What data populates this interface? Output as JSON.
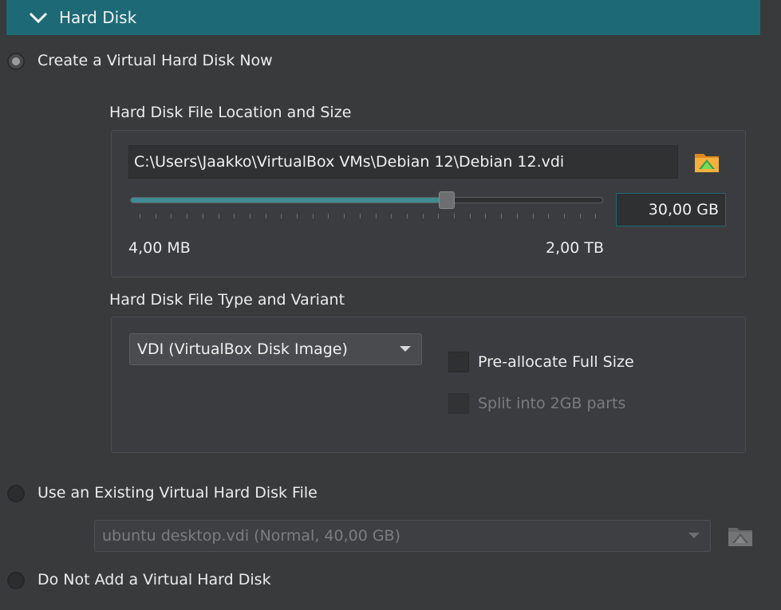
{
  "section": {
    "title": "Hard Disk"
  },
  "options": {
    "create": {
      "label": "Create a Virtual Hard Disk Now",
      "selected": true
    },
    "existing": {
      "label": "Use an Existing Virtual Hard Disk File",
      "selected": false
    },
    "none": {
      "label": "Do Not Add a Virtual Hard Disk",
      "selected": false
    }
  },
  "location": {
    "heading": "Hard Disk File Location and Size",
    "path": "C:\\Users\\Jaakko\\VirtualBox VMs\\Debian 12\\Debian 12.vdi",
    "folder_icon": "folder-browse-icon",
    "size_value": "30,00 GB",
    "slider_fraction": 0.67,
    "min_label": "4,00 MB",
    "max_label": "2,00 TB"
  },
  "type": {
    "heading": "Hard Disk File Type and Variant",
    "selected_format": "VDI (VirtualBox Disk Image)",
    "preallocate_label": "Pre-allocate Full Size",
    "preallocate_checked": false,
    "split_label": "Split into 2GB parts",
    "split_checked": false,
    "split_enabled": false
  },
  "existing_disk": {
    "selected": "ubuntu desktop.vdi (Normal, 40,00 GB)",
    "enabled": false
  },
  "colors": {
    "accent": "#1d6a76",
    "slider_fill": "#3f8c93",
    "background": "#393a3c"
  }
}
